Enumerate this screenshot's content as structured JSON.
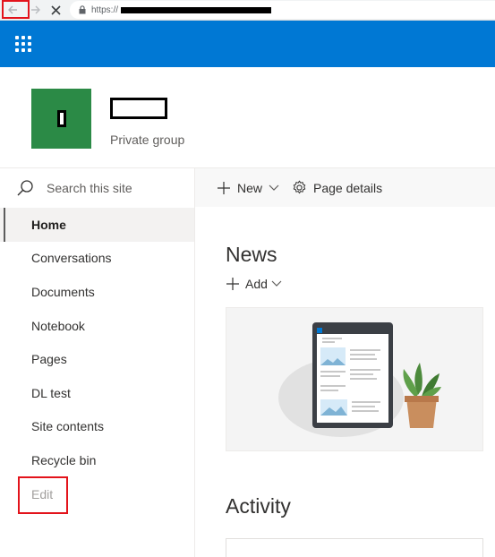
{
  "browser": {
    "url_prefix": "https://",
    "back_icon": "arrow-left-icon",
    "forward_icon": "arrow-right-icon",
    "close_icon": "close-icon",
    "lock_icon": "lock-icon"
  },
  "suite_bar": {
    "app_launcher_icon": "waffle-icon",
    "color": "#0078d4"
  },
  "site": {
    "privacy_label": "Private group",
    "logo_color": "#2b8a46"
  },
  "search": {
    "placeholder": "Search this site"
  },
  "nav": {
    "items": [
      {
        "label": "Home",
        "active": true
      },
      {
        "label": "Conversations"
      },
      {
        "label": "Documents"
      },
      {
        "label": "Notebook"
      },
      {
        "label": "Pages"
      },
      {
        "label": "DL test"
      },
      {
        "label": "Site contents"
      },
      {
        "label": "Recycle bin"
      },
      {
        "label": "Edit"
      }
    ]
  },
  "command_bar": {
    "new_label": "New",
    "page_details_label": "Page details"
  },
  "main": {
    "news_title": "News",
    "add_label": "Add",
    "activity_title": "Activity"
  },
  "highlight_color": "#e3131b"
}
